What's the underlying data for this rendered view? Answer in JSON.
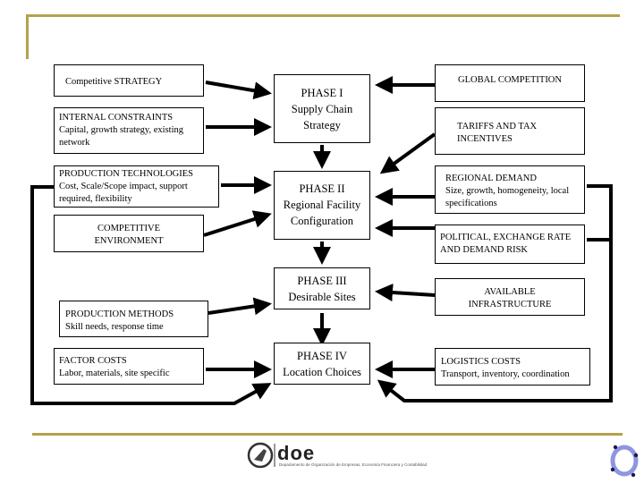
{
  "slide": {
    "accent_color": "#b3a24d",
    "left_factors": [
      {
        "title": "Competitive STRATEGY",
        "subtitle": ""
      },
      {
        "title": "INTERNAL CONSTRAINTS",
        "subtitle": "Capital, growth strategy, existing network"
      },
      {
        "title": "PRODUCTION TECHNOLOGIES",
        "subtitle": "Cost, Scale/Scope impact, support required, flexibility"
      },
      {
        "title": "COMPETITIVE ENVIRONMENT",
        "subtitle": ""
      },
      {
        "title": "PRODUCTION METHODS",
        "subtitle": "Skill needs, response time"
      },
      {
        "title": "FACTOR COSTS",
        "subtitle": "Labor, materials, site specific"
      }
    ],
    "phases": [
      {
        "title": "PHASE I",
        "subtitle": "Supply Chain Strategy"
      },
      {
        "title": "PHASE II",
        "subtitle": "Regional Facility Configuration"
      },
      {
        "title": "PHASE III",
        "subtitle": "Desirable Sites"
      },
      {
        "title": "PHASE IV",
        "subtitle": "Location Choices"
      }
    ],
    "right_factors": [
      {
        "title": "GLOBAL COMPETITION",
        "subtitle": ""
      },
      {
        "title": "TARIFFS AND TAX INCENTIVES",
        "subtitle": ""
      },
      {
        "title": "REGIONAL DEMAND",
        "subtitle": "Size, growth, homogeneity, local specifications"
      },
      {
        "title": "POLITICAL, EXCHANGE RATE AND DEMAND RISK",
        "subtitle": ""
      },
      {
        "title": "AVAILABLE INFRASTRUCTURE",
        "subtitle": ""
      },
      {
        "title": "LOGISTICS COSTS",
        "subtitle": "Transport, inventory, coordination"
      }
    ]
  },
  "footer": {
    "logo_text": "doe",
    "caption": "Departamento de Organización de Empresas, Economía Financiera y Contabilidad"
  }
}
